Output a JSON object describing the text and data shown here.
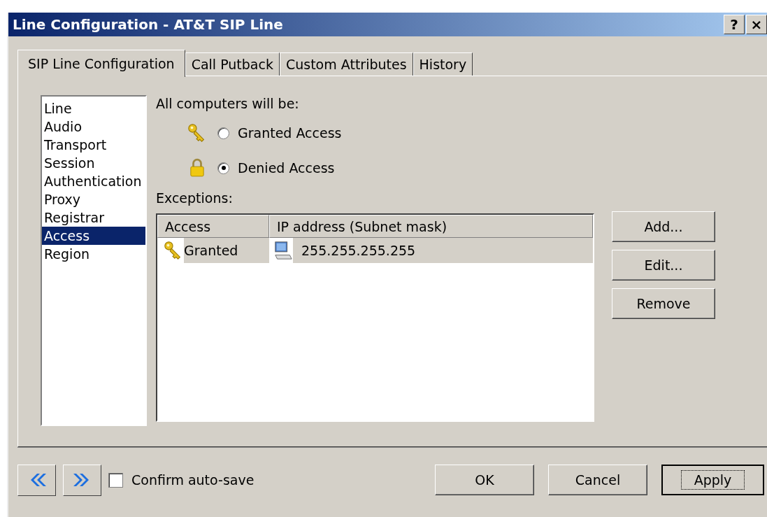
{
  "window": {
    "title": "Line Configuration - AT&T SIP Line",
    "title_buttons": [
      "?",
      "×"
    ]
  },
  "tabs": [
    {
      "label": "SIP Line Configuration",
      "selected": true
    },
    {
      "label": "Call Putback",
      "selected": false
    },
    {
      "label": "Custom Attributes",
      "selected": false
    },
    {
      "label": "History",
      "selected": false
    }
  ],
  "sidebar": {
    "items": [
      {
        "label": "Line",
        "selected": false
      },
      {
        "label": "Audio",
        "selected": false
      },
      {
        "label": "Transport",
        "selected": false
      },
      {
        "label": "Session",
        "selected": false
      },
      {
        "label": "Authentication",
        "selected": false
      },
      {
        "label": "Proxy",
        "selected": false
      },
      {
        "label": "Registrar",
        "selected": false
      },
      {
        "label": "Access",
        "selected": true
      },
      {
        "label": "Region",
        "selected": false
      }
    ]
  },
  "access": {
    "label": "All computers will be:",
    "options": [
      {
        "kind": "key",
        "label": "Granted Access",
        "selected": false
      },
      {
        "kind": "lock",
        "label": "Denied Access",
        "selected": true
      }
    ]
  },
  "exceptions": {
    "label": "Exceptions:",
    "columns": [
      "Access",
      "IP address (Subnet mask)"
    ],
    "rows": [
      {
        "access": "Granted",
        "address": "255.255.255.255"
      }
    ]
  },
  "side_buttons": [
    "Add...",
    "Edit...",
    "Remove"
  ],
  "footer": {
    "confirm_autosave": {
      "label": "Confirm auto-save",
      "checked": false
    },
    "buttons": [
      {
        "label": "OK",
        "default": false
      },
      {
        "label": "Cancel",
        "default": false
      },
      {
        "label": "Apply",
        "default": true
      }
    ]
  }
}
